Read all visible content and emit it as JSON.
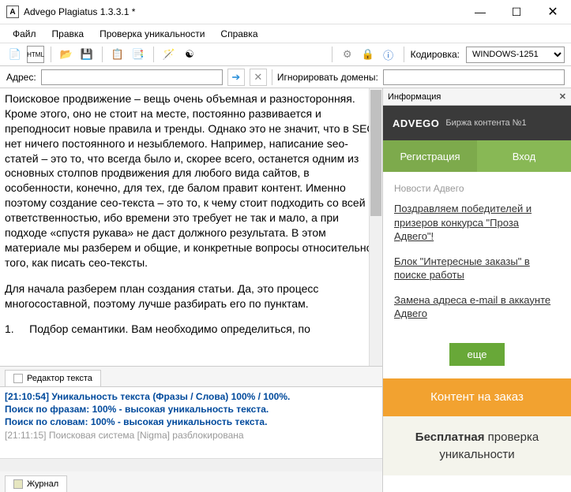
{
  "window": {
    "title": "Advego Plagiatus 1.3.3.1 *",
    "app_icon_letter": "A"
  },
  "menu": {
    "file": "Файл",
    "edit": "Правка",
    "check": "Проверка уникальности",
    "help": "Справка"
  },
  "toolbar": {
    "encoding_label": "Кодировка:",
    "encoding_value": "WINDOWS-1251"
  },
  "address": {
    "label": "Адрес:",
    "value": "",
    "ignore_label": "Игнорировать домены:",
    "ignore_value": ""
  },
  "editor": {
    "para1": "Поисковое продвижение – вещь очень объемная и разносторонняя. Кроме этого, оно не стоит на месте, постоянно развивается и преподносит новые правила и тренды. Однако это не значит, что в SEO нет ничего постоянного и незыблемого. Например, написание seo-статей – это то, что всегда было и, скорее всего, останется одним из основных столпов продвижения для любого вида сайтов, в особенности, конечно, для тех, где балом правит контент. Именно поэтому создание сео-текста – это то, к чему стоит подходить со всей ответственностью, ибо времени это требует не так и мало, а при подходе «спустя рукава» не даст должного результата. В этом материале мы разберем и общие, и конкретные вопросы относительно того, как писать сео-тексты.",
    "para2": "Для начала разберем план создания статьи. Да, это процесс многосоставной, поэтому лучше разбирать его по пунктам.",
    "list_num": "1.",
    "list_item": "Подбор семантики. Вам необходимо определиться, по"
  },
  "tabs": {
    "editor_tab": "Редактор текста",
    "log_tab": "Журнал"
  },
  "log": {
    "line1": "[21:10:54] Уникальность текста (Фразы / Слова) 100% / 100%.",
    "line2": "Поиск по фразам: 100% - высокая уникальность текста.",
    "line3": "Поиск по словам: 100% - высокая уникальность текста.",
    "line4": "[21:11:15] Поисковая система [Nigma] разблокирована"
  },
  "info": {
    "header": "Информация",
    "brand": "ADVEGO",
    "slogan": "Биржа контента №1",
    "register": "Регистрация",
    "login": "Вход",
    "news_heading": "Новости Адвего",
    "news1": "Поздравляем победителей и призеров конкурса \"Проза Адвего\"!",
    "news2": "Блок \"Интересные заказы\" в поиске работы",
    "news3": "Замена адреса e-mail в аккаунте Адвего",
    "more": "еще",
    "order": "Контент на заказ",
    "free_bold": "Бесплатная",
    "free_rest": " проверка уникальности"
  }
}
